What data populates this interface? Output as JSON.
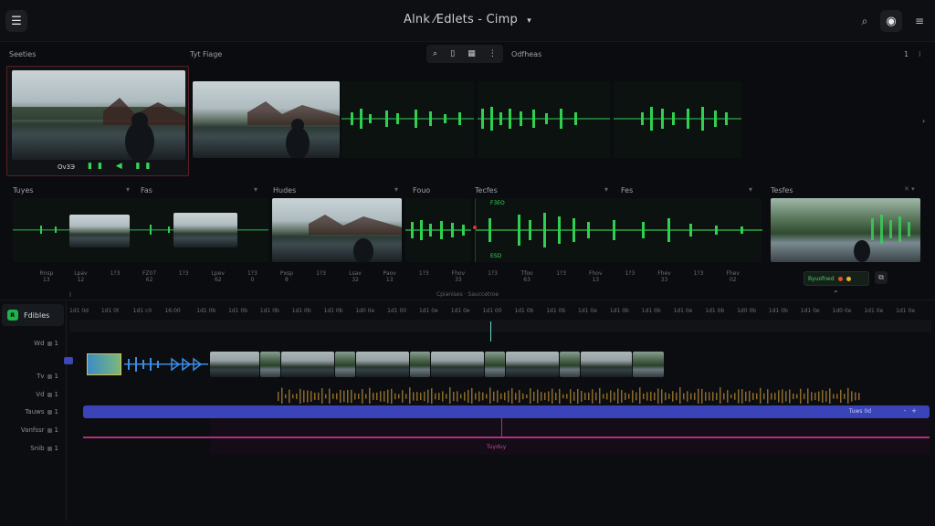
{
  "titlebar": {
    "title": "Alnk ⁄Edlets - Cimp",
    "menu_icon": "menu-icon",
    "dropdown_icon": "chevron-down-icon"
  },
  "top_labels": {
    "left": "Seeties",
    "mid": "Tyt Fiage",
    "right": "Odfheas"
  },
  "toolbar_right": [
    "1",
    "⁝"
  ],
  "first_clip_caption": "Ov3Э",
  "row2_headers": [
    "Tuyes",
    "Fas",
    "Hudes",
    "Fouo",
    "Tecfes",
    "Fes",
    "Tesfes"
  ],
  "row2_markers": [
    "F3EO",
    "ESD"
  ],
  "row2_stats": [
    [
      "Rnsp",
      "13"
    ],
    [
      "Lpav",
      "12"
    ],
    [
      "1?3",
      ""
    ],
    [
      "FZ07",
      "62"
    ],
    [
      "1?3",
      ""
    ],
    [
      "Lpev",
      "62"
    ],
    [
      "1?3",
      "0"
    ],
    [
      "Pxsp",
      "8"
    ],
    [
      "1?3",
      ""
    ],
    [
      "Lsav",
      "32"
    ],
    [
      "Paov",
      "13"
    ],
    [
      "1?3",
      ""
    ],
    [
      "Fhov",
      "33"
    ],
    [
      "1?3",
      ""
    ],
    [
      "Tfoo",
      "63"
    ],
    [
      "1?3",
      ""
    ],
    [
      "Fhov",
      "13"
    ],
    [
      "1?3",
      ""
    ],
    [
      "Fhev",
      "33"
    ],
    [
      "1?3",
      ""
    ],
    [
      "Fhev",
      "02"
    ]
  ],
  "action_chip": {
    "label": "Byuofned",
    "colors": [
      "#e24d2c",
      "#e6b32a"
    ]
  },
  "ruler_caption": "Cpianises · Sauccetroe",
  "ruler_hint": "I",
  "timeline_header": {
    "title": "Fdibles",
    "logo_icon": "app-logo-icon"
  },
  "ruler_ticks": [
    "1d1 0d",
    "1d1 0t",
    "1d1 c0",
    "16:00",
    "1d1 0b",
    "1d1 0b",
    "1d1 0b",
    "1d1 0b",
    "1d1 0b",
    "1d0 0e",
    "1d1 00",
    "1d1 0e",
    "1d1 0e",
    "1d1 00",
    "1d1 0b",
    "1d1 0b",
    "1d1 0e",
    "1d1 0b",
    "1d1 0b",
    "1d1 0e",
    "1d1 0b",
    "1d0 0b",
    "1d1 0b",
    "1d1 0e",
    "1d0 0e",
    "1d1 0e",
    "1d1 0e"
  ],
  "tracks": [
    {
      "name": "Wd",
      "num": "1"
    },
    {
      "name": "Tv",
      "num": "1"
    },
    {
      "name": "Vd",
      "num": "1"
    },
    {
      "name": "Tauws",
      "num": "1"
    },
    {
      "name": "Vanfssr",
      "num": "1"
    },
    {
      "name": "Snib",
      "num": "1"
    }
  ],
  "blue_bar": {
    "label": "Tuws 0d",
    "controls": [
      "-",
      "+"
    ],
    "color": "#3a43b8"
  },
  "magenta_bar": {
    "label": "Tuyduy",
    "color": "#b0307a"
  },
  "accent": "#37d65a"
}
